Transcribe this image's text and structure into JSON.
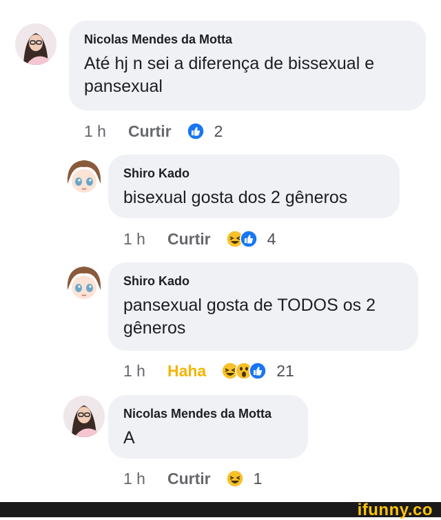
{
  "comments": [
    {
      "author": "Nicolas Mendes da Motta",
      "text": "Até hj n sei a diferença de bissexual e pansexual",
      "time": "1 h",
      "action": "Curtir",
      "reactions": [
        "like-reaction-icon"
      ],
      "count": "2"
    },
    {
      "author": "Shiro Kado",
      "text": "bisexual gosta dos 2 gêneros",
      "time": "1 h",
      "action": "Curtir",
      "reactions": [
        "haha-reaction-icon",
        "like-reaction-icon"
      ],
      "count": "4"
    },
    {
      "author": "Shiro Kado",
      "text": "pansexual gosta de TODOS os 2 gêneros",
      "time": "1 h",
      "action": "Haha",
      "reactions": [
        "haha-reaction-icon",
        "wow-reaction-icon",
        "like-reaction-icon"
      ],
      "count": "21"
    },
    {
      "author": "Nicolas Mendes da Motta",
      "text": "A",
      "time": "1 h",
      "action": "Curtir",
      "reactions": [
        "haha-reaction-icon"
      ],
      "count": "1"
    }
  ],
  "footer": {
    "watermark": "ifunny.co"
  },
  "colors": {
    "bubble": "#eff1f5",
    "like": "#1877f2",
    "haha": "#f5b400",
    "muted": "#65676b"
  }
}
